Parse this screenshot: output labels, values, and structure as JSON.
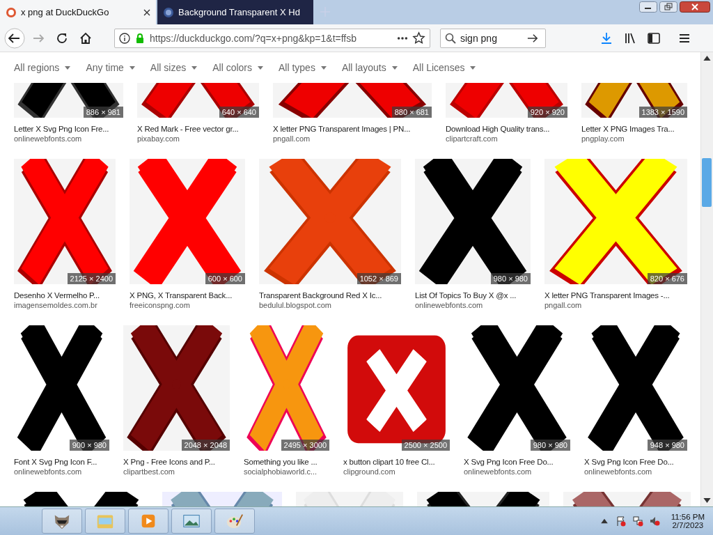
{
  "tabs": [
    {
      "title": "x png at DuckDuckGo",
      "selected": true
    },
    {
      "title": "Background Transparent X Hd",
      "selected": false
    }
  ],
  "address": {
    "url": "https://duckduckgo.com/?q=x+png&kp=1&t=ffsb"
  },
  "search": {
    "value": "sign png"
  },
  "filters": [
    "All regions",
    "Any time",
    "All sizes",
    "All colors",
    "All types",
    "All layouts",
    "All Licenses"
  ],
  "rows": [
    {
      "items": [
        {
          "kind": "result",
          "size": "886 × 981",
          "title": "Letter X Svg Png Icon Fre...",
          "source": "onlinewebfonts.com"
        },
        {
          "kind": "result",
          "size": "640 × 640",
          "title": "X Red Mark - Free vector gr...",
          "source": "pixabay.com"
        },
        {
          "kind": "result",
          "size": "880 × 681",
          "title": "X letter PNG Transparent Images | PN...",
          "source": "pngall.com"
        },
        {
          "kind": "result",
          "size": "920 × 920",
          "title": "Download High Quality trans...",
          "source": "clipartcraft.com"
        },
        {
          "kind": "result",
          "size": "1383 × 1590",
          "title": "Letter X PNG Images Tra...",
          "source": "pngplay.com"
        }
      ]
    },
    {
      "items": [
        {
          "kind": "result",
          "size": "2125 × 2400",
          "title": "Desenho X Vermelho P...",
          "source": "imagensemoldes.com.br"
        },
        {
          "kind": "result",
          "size": "600 × 600",
          "title": "X PNG, X Transparent Back...",
          "source": "freeiconspng.com"
        },
        {
          "kind": "result",
          "size": "1052 × 869",
          "title": "Transparent Background Red X Ic...",
          "source": "bedulul.blogspot.com"
        },
        {
          "kind": "result",
          "size": "980 × 980",
          "title": "List Of Topics To Buy X @x ...",
          "source": "onlinewebfonts.com"
        },
        {
          "kind": "result",
          "size": "820 × 676",
          "title": "X letter PNG Transparent Images -...",
          "source": "pngall.com"
        }
      ]
    },
    {
      "items": [
        {
          "kind": "result",
          "size": "900 × 980",
          "title": "Font X Svg Png Icon F...",
          "source": "onlinewebfonts.com"
        },
        {
          "kind": "result",
          "size": "2048 × 2048",
          "title": "X Png - Free Icons and P...",
          "source": "clipartbest.com"
        },
        {
          "kind": "result",
          "size": "2495 × 3000",
          "title": "Something you like ...",
          "source": "socialphobiaworld.c..."
        },
        {
          "kind": "result",
          "size": "2500 × 2500",
          "title": "x button clipart 10 free Cl...",
          "source": "clipground.com"
        },
        {
          "kind": "result",
          "size": "980 × 980",
          "title": "X Svg Png Icon Free Do...",
          "source": "onlinewebfonts.com"
        },
        {
          "kind": "result",
          "size": "948 × 980",
          "title": "X Svg Png Icon Free Do...",
          "source": "onlinewebfonts.com"
        }
      ]
    },
    {
      "items": [
        {
          "kind": "picture"
        },
        {
          "kind": "picture"
        },
        {
          "kind": "picture"
        },
        {
          "kind": "picture"
        },
        {
          "kind": "picture"
        }
      ]
    }
  ],
  "clock": {
    "time": "11:56 PM",
    "date": "2/7/2023"
  }
}
